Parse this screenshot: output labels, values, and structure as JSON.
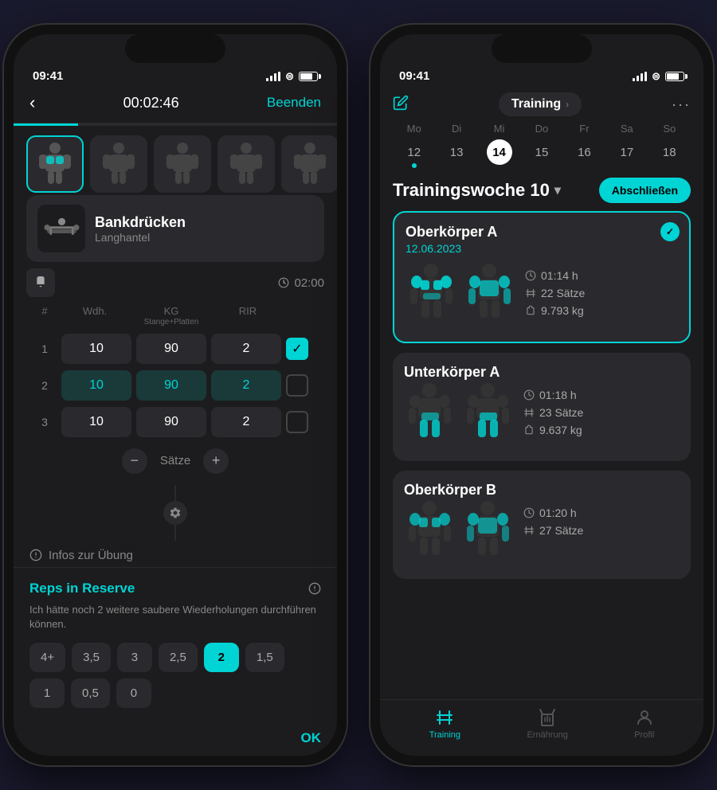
{
  "left_phone": {
    "status": {
      "time": "09:41"
    },
    "header": {
      "timer": "00:02:46",
      "end_btn": "Beenden"
    },
    "exercise": {
      "name": "Bankdrücken",
      "equipment": "Langhantel"
    },
    "rest_timer": "02:00",
    "sets_header": {
      "col1": "#",
      "col2": "Wdh.",
      "col3": "KG",
      "col3_sub": "Stange+Platten",
      "col4": "RIR"
    },
    "sets": [
      {
        "num": "1",
        "reps": "10",
        "kg": "90",
        "rir": "2",
        "checked": true
      },
      {
        "num": "2",
        "reps": "10",
        "kg": "90",
        "rir": "2",
        "checked": false
      },
      {
        "num": "3",
        "reps": "10",
        "kg": "90",
        "rir": "2",
        "checked": false
      }
    ],
    "sets_label": "Sätze",
    "info_label": "Infos zur Übung",
    "rir_panel": {
      "title": "Reps in Reserve",
      "description": "Ich hätte noch 2 weitere saubere Wiederholungen durchführen können.",
      "buttons": [
        "4+",
        "3,5",
        "3",
        "2,5",
        "2",
        "1,5",
        "1",
        "0,5",
        "0"
      ],
      "selected": "2",
      "ok": "OK"
    }
  },
  "right_phone": {
    "status": {
      "time": "09:41"
    },
    "header": {
      "title": "Training",
      "more_icon": "···"
    },
    "calendar": {
      "days": [
        "Mo",
        "Di",
        "Mi",
        "Do",
        "Fr",
        "Sa",
        "So"
      ],
      "dates": [
        "12",
        "13",
        "14",
        "15",
        "16",
        "17",
        "18"
      ],
      "today_index": 2,
      "dot_index": 0
    },
    "week_title": "Trainingswoche 10",
    "finish_btn": "Abschließen",
    "workouts": [
      {
        "title": "Oberkörper A",
        "date": "12.06.2023",
        "active": true,
        "stats": {
          "time": "01:14 h",
          "sets": "22 Sätze",
          "weight": "9.793 kg"
        }
      },
      {
        "title": "Unterkörper A",
        "date": null,
        "active": false,
        "stats": {
          "time": "01:18 h",
          "sets": "23 Sätze",
          "weight": "9.637 kg"
        }
      },
      {
        "title": "Oberkörper B",
        "date": null,
        "active": false,
        "stats": {
          "time": "01:20 h",
          "sets": "27 Sätze",
          "weight": ""
        }
      }
    ],
    "tabs": [
      {
        "label": "Training",
        "active": true
      },
      {
        "label": "Ernährung",
        "active": false
      },
      {
        "label": "Profil",
        "active": false
      }
    ]
  }
}
